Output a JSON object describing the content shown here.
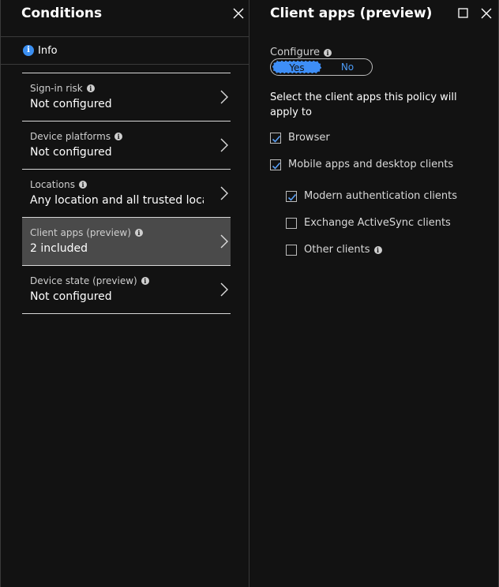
{
  "left_blade": {
    "title": "Conditions",
    "info_label": "Info",
    "conditions": [
      {
        "label": "Sign-in risk",
        "value": "Not configured"
      },
      {
        "label": "Device platforms",
        "value": "Not configured"
      },
      {
        "label": "Locations",
        "value": "Any location and all trusted locat..."
      },
      {
        "label": "Client apps (preview)",
        "value": "2 included",
        "selected": true
      },
      {
        "label": "Device state (preview)",
        "value": "Not configured"
      }
    ]
  },
  "right_blade": {
    "title": "Client apps (preview)",
    "configure_label": "Configure",
    "toggle": {
      "yes": "Yes",
      "no": "No",
      "selected": "Yes"
    },
    "description": "Select the client apps this policy will apply to",
    "checkboxes": [
      {
        "label": "Browser",
        "checked": true
      },
      {
        "label": "Mobile apps and desktop clients",
        "checked": true
      },
      {
        "label": "Modern authentication clients",
        "checked": true
      },
      {
        "label": "Exchange ActiveSync clients",
        "checked": false
      },
      {
        "label": "Other clients",
        "checked": false
      }
    ]
  },
  "colors": {
    "accent": "#3e8ef7",
    "background": "#121212",
    "selected_row": "#4a4a4a"
  }
}
